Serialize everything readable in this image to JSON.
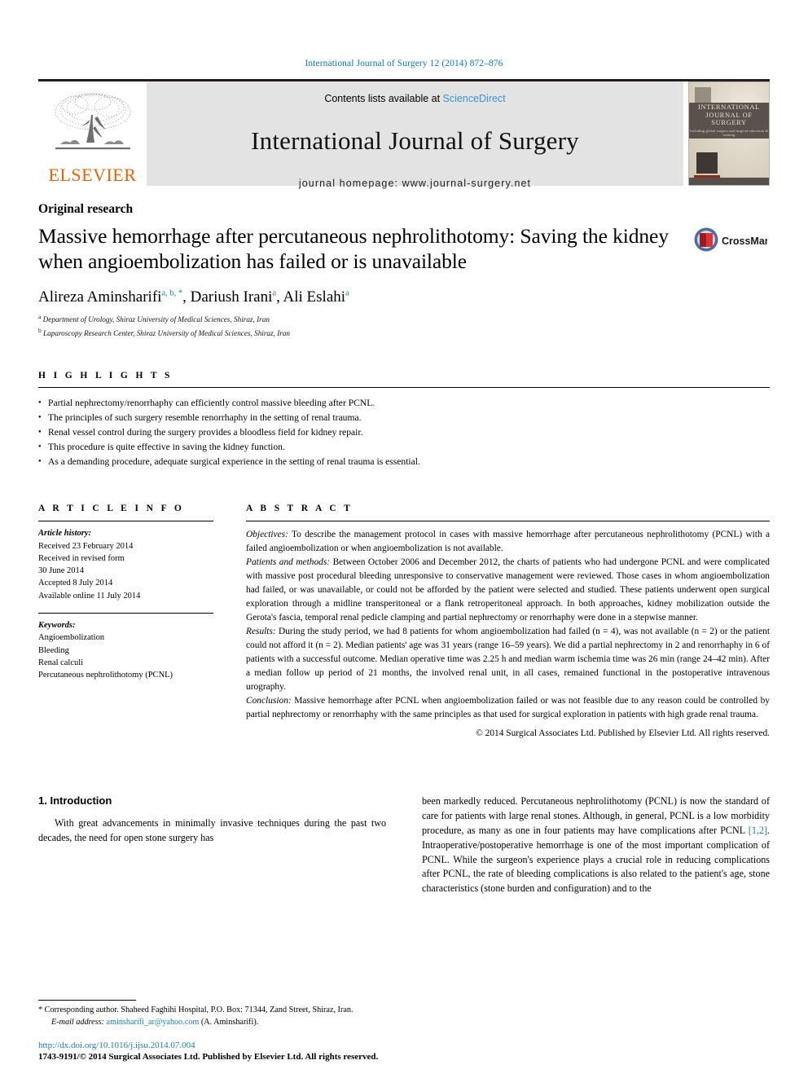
{
  "running_head": "International Journal of Surgery 12 (2014) 872–876",
  "banner": {
    "publisher_logo_label": "ELSEVIER",
    "contents_prefix": "Contents lists available at ",
    "sciencedirect": "ScienceDirect",
    "journal_title": "International Journal of Surgery",
    "homepage": "journal homepage: www.journal-surgery.net",
    "cover": {
      "title_line1": "INTERNATIONAL",
      "title_line2": "JOURNAL OF SURGERY",
      "subtitle": "Including global surgery and surgical education & training"
    },
    "colors": {
      "link_blue": "#3a94d3",
      "elsevier_orange": "#eb6209",
      "banner_gray": "#e3e3e3"
    }
  },
  "article": {
    "type": "Original research",
    "title": "Massive hemorrhage after percutaneous nephrolithotomy: Saving the kidney when angioembolization has failed or is unavailable",
    "crossmark_label": "CrossMark",
    "authors": [
      {
        "name": "Alireza Aminsharifi",
        "marks": "a, b, *"
      },
      {
        "name": "Dariush Irani",
        "marks": "a"
      },
      {
        "name": "Ali Eslahi",
        "marks": "a"
      }
    ],
    "affiliations": [
      {
        "mark": "a",
        "text": "Department of Urology, Shiraz University of Medical Sciences, Shiraz, Iran"
      },
      {
        "mark": "b",
        "text": "Laparoscopy Research Center, Shiraz University of Medical Sciences, Shiraz, Iran"
      }
    ]
  },
  "highlights": {
    "heading": "H I G H L I G H T S",
    "items": [
      "Partial nephrectomy/renorrhaphy can efficiently control massive bleeding after PCNL.",
      "The principles of such surgery resemble renorrhaphy in the setting of renal trauma.",
      "Renal vessel control during the surgery provides a bloodless field for kidney repair.",
      "This procedure is quite effective in saving the kidney function.",
      "As a demanding procedure, adequate surgical experience in the setting of renal trauma is essential."
    ]
  },
  "article_info": {
    "heading": "A R T I C L E  I N F O",
    "history_label": "Article history:",
    "history": [
      "Received 23 February 2014",
      "Received in revised form",
      "30 June 2014",
      "Accepted 8 July 2014",
      "Available online 11 July 2014"
    ],
    "keywords_label": "Keywords:",
    "keywords": [
      "Angioembolization",
      "Bleeding",
      "Renal calculi",
      "Percutaneous nephrolithotomy (PCNL)"
    ]
  },
  "abstract": {
    "heading": "A B S T R A C T",
    "sections": [
      {
        "label": "Objectives:",
        "text": " To describe the management protocol in cases with massive hemorrhage after percutaneous nephrolithotomy (PCNL) with a failed angioembolization or when angioembolization is not available."
      },
      {
        "label": "Patients and methods:",
        "text": " Between October 2006 and December 2012, the charts of patients who had undergone PCNL and were complicated with massive post procedural bleeding unresponsive to conservative management were reviewed. Those cases in whom angioembolization had failed, or was unavailable, or could not be afforded by the patient were selected and studied. These patients underwent open surgical exploration through a midline transperitoneal or a flank retroperitoneal approach. In both approaches, kidney mobilization outside the Gerota's fascia, temporal renal pedicle clamping and partial nephrectomy or renorrhaphy were done in a stepwise manner."
      },
      {
        "label": "Results:",
        "text": " During the study period, we had 8 patients for whom angioembolization had failed (n = 4), was not available (n = 2) or the patient could not afford it (n = 2). Median patients' age was 31 years (range 16–59 years). We did a partial nephrectomy in 2 and renorrhaphy in 6 of patients with a successful outcome. Median operative time was 2.25 h and median warm ischemia time was 26 min (range 24–42 min). After a median follow up period of 21 months, the involved renal unit, in all cases, remained functional in the postoperative intravenous urography."
      },
      {
        "label": "Conclusion:",
        "text": " Massive hemorrhage after PCNL when angioembolization failed or was not feasible due to any reason could be controlled by partial nephrectomy or renorrhaphy with the same principles as that used for surgical exploration in patients with high grade renal trauma."
      }
    ],
    "copyright": "© 2014 Surgical Associates Ltd. Published by Elsevier Ltd. All rights reserved."
  },
  "body": {
    "section_number_title": "1. Introduction",
    "left_paragraph": "With great advancements in minimally invasive techniques during the past two decades, the need for open stone surgery has",
    "right_paragraph_1": "been markedly reduced. Percutaneous nephrolithotomy (PCNL) is now the standard of care for patients with large renal stones. Although, in general, PCNL is a low morbidity procedure, as many as one in four patients may have complications after PCNL ",
    "right_citation": "[1,2]",
    "right_paragraph_2": ". Intraoperative/postoperative hemorrhage is one of the most important complication of PCNL. While the surgeon's experience plays a crucial role in reducing complications after PCNL, the rate of bleeding complications is also related to the patient's age, stone characteristics (stone burden and configuration) and to the"
  },
  "footnote": {
    "corresponding": "* Corresponding author. Shaheed Faghihi Hospital, P.O. Box: 71344, Zand Street, Shiraz, Iran.",
    "email_label": "E-mail address:",
    "email": "aminsharifi_ar@yahoo.com",
    "email_owner": "(A. Aminsharifi)."
  },
  "bottom": {
    "doi": "http://dx.doi.org/10.1016/j.ijsu.2014.07.004",
    "issn_line": "1743-9191/© 2014 Surgical Associates Ltd. Published by Elsevier Ltd. All rights reserved."
  }
}
